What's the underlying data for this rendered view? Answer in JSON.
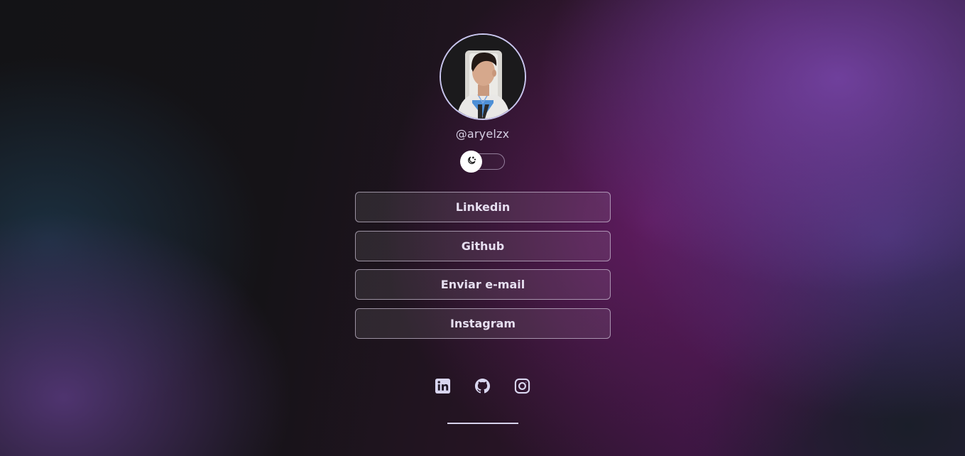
{
  "profile": {
    "handle": "@aryelzx",
    "avatar_icon": "profile-photo"
  },
  "theme_toggle": {
    "icon": "moon-stars-icon",
    "state": "dark"
  },
  "links": [
    {
      "label": "Linkedin"
    },
    {
      "label": "Github"
    },
    {
      "label": "Enviar e-mail"
    },
    {
      "label": "Instagram"
    }
  ],
  "socials": [
    {
      "icon": "linkedin-icon"
    },
    {
      "icon": "github-icon"
    },
    {
      "icon": "instagram-icon"
    }
  ],
  "colors": {
    "text": "#e6dff0",
    "accent_border": "#c9c6ee",
    "button_border": "#d7cde1",
    "background_dark": "#131316",
    "background_purple": "#6e1e6e"
  }
}
